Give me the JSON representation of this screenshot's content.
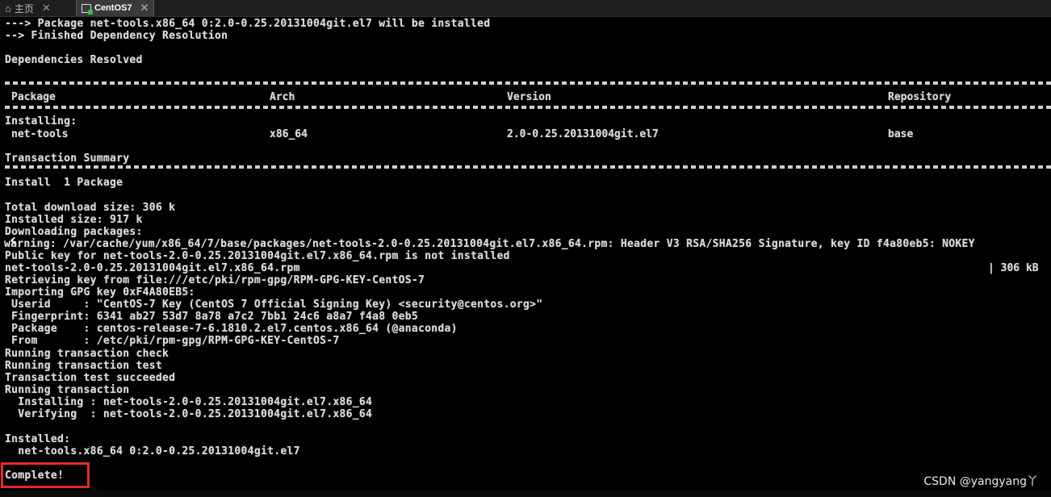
{
  "tabs": [
    {
      "label": "主页",
      "icon": "home-icon"
    },
    {
      "label": "CentOS7",
      "icon": "vm-icon"
    }
  ],
  "terminal": {
    "lines_top": [
      "---> Package net-tools.x86_64 0:2.0-0.25.20131004git.el7 will be installed",
      "--> Finished Dependency Resolution",
      "",
      "Dependencies Resolved"
    ],
    "table_header": {
      "package": "Package",
      "arch": "Arch",
      "version": "Version",
      "repository": "Repository"
    },
    "installing_label": "Installing:",
    "table_row": {
      "package": "net-tools",
      "arch": "x86_64",
      "version": "2.0-0.25.20131004git.el7",
      "repository": "base"
    },
    "transaction_summary": "Transaction Summary",
    "install_count": "Install  1 Package",
    "lines_mid": [
      "Total download size: 306 k",
      "Installed size: 917 k",
      "Downloading packages:",
      "warning: /var/cache/yum/x86_64/7/base/packages/net-tools-2.0-0.25.20131004git.el7.x86_64.rpm: Header V3 RSA/SHA256 Signature, key ID f4a80eb5: NOKEY",
      "Public key for net-tools-2.0-0.25.20131004git.el7.x86_64.rpm is not installed",
      "net-tools-2.0-0.25.20131004git.el7.x86_64.rpm",
      "Retrieving key from file:///etc/pki/rpm-gpg/RPM-GPG-KEY-CentOS-7",
      "Importing GPG key 0xF4A80EB5:",
      " Userid     : \"CentOS-7 Key (CentOS 7 Official Signing Key) <security@centos.org>\"",
      " Fingerprint: 6341 ab27 53d7 8a78 a7c2 7bb1 24c6 a8a7 f4a8 0eb5",
      " Package    : centos-release-7-6.1810.2.el7.centos.x86_64 (@anaconda)",
      " From       : /etc/pki/rpm-gpg/RPM-GPG-KEY-CentOS-7",
      "Running transaction check",
      "Running transaction test",
      "Transaction test succeeded",
      "Running transaction",
      "  Installing : net-tools-2.0-0.25.20131004git.el7.x86_64",
      "  Verifying  : net-tools-2.0-0.25.20131004git.el7.x86_64",
      "",
      "Installed:",
      "  net-tools.x86_64 0:2.0-0.25.20131004git.el7",
      "",
      "Complete!"
    ],
    "download_size_right": "| 306 kB"
  },
  "watermark": "CSDN @yangyang丫",
  "colors": {
    "background": "#000000",
    "text": "#d8d8d8",
    "highlight": "#e12b2b"
  }
}
